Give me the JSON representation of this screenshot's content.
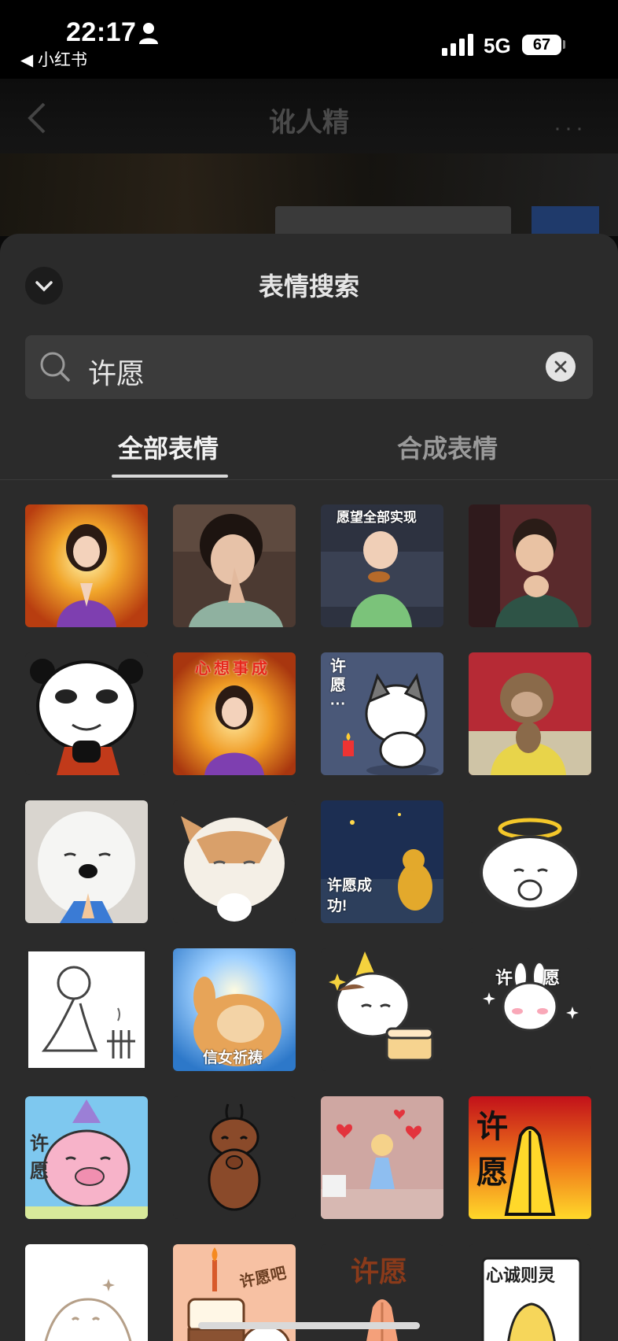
{
  "status_bar": {
    "time": "22:17",
    "back_app": "◀ 小红书",
    "network": "5G",
    "battery": "67"
  },
  "background_page": {
    "title": "讹人精",
    "more": "···"
  },
  "sheet": {
    "title": "表情搜索",
    "search_value": "许愿",
    "tabs": [
      "全部表情",
      "合成表情"
    ],
    "active_tab": "全部表情"
  },
  "stickers": [
    {
      "name": "girl-praying-golden"
    },
    {
      "name": "woman-praying-costume"
    },
    {
      "name": "child-birthday-cake",
      "caption": "愿望全部实现"
    },
    {
      "name": "child-praying"
    },
    {
      "name": "panda-praying"
    },
    {
      "name": "girl-praying-wish",
      "caption": "心想事成"
    },
    {
      "name": "husky-praying-candle",
      "caption": "许愿···"
    },
    {
      "name": "monkey-praying"
    },
    {
      "name": "samoyed-praying"
    },
    {
      "name": "cat-praying"
    },
    {
      "name": "bird-wish-night",
      "caption": "许愿成功!"
    },
    {
      "name": "angel-cloud-praying"
    },
    {
      "name": "stickman-praying-incense"
    },
    {
      "name": "cat-believer",
      "caption": "信女祈祷"
    },
    {
      "name": "cat-birthday-cake"
    },
    {
      "name": "bunny-wish",
      "caption": "许愿"
    },
    {
      "name": "pig-birthday-wish",
      "caption": "许 愿"
    },
    {
      "name": "bug-praying"
    },
    {
      "name": "girl-hearts-praying"
    },
    {
      "name": "hands-wish",
      "caption": "许愿"
    },
    {
      "name": "seal-sketch"
    },
    {
      "name": "cake-wish",
      "caption": "许愿吧"
    },
    {
      "name": "hands-wish-2",
      "caption": "许愿"
    },
    {
      "name": "banana-sincere",
      "caption": "心诚则灵"
    }
  ]
}
